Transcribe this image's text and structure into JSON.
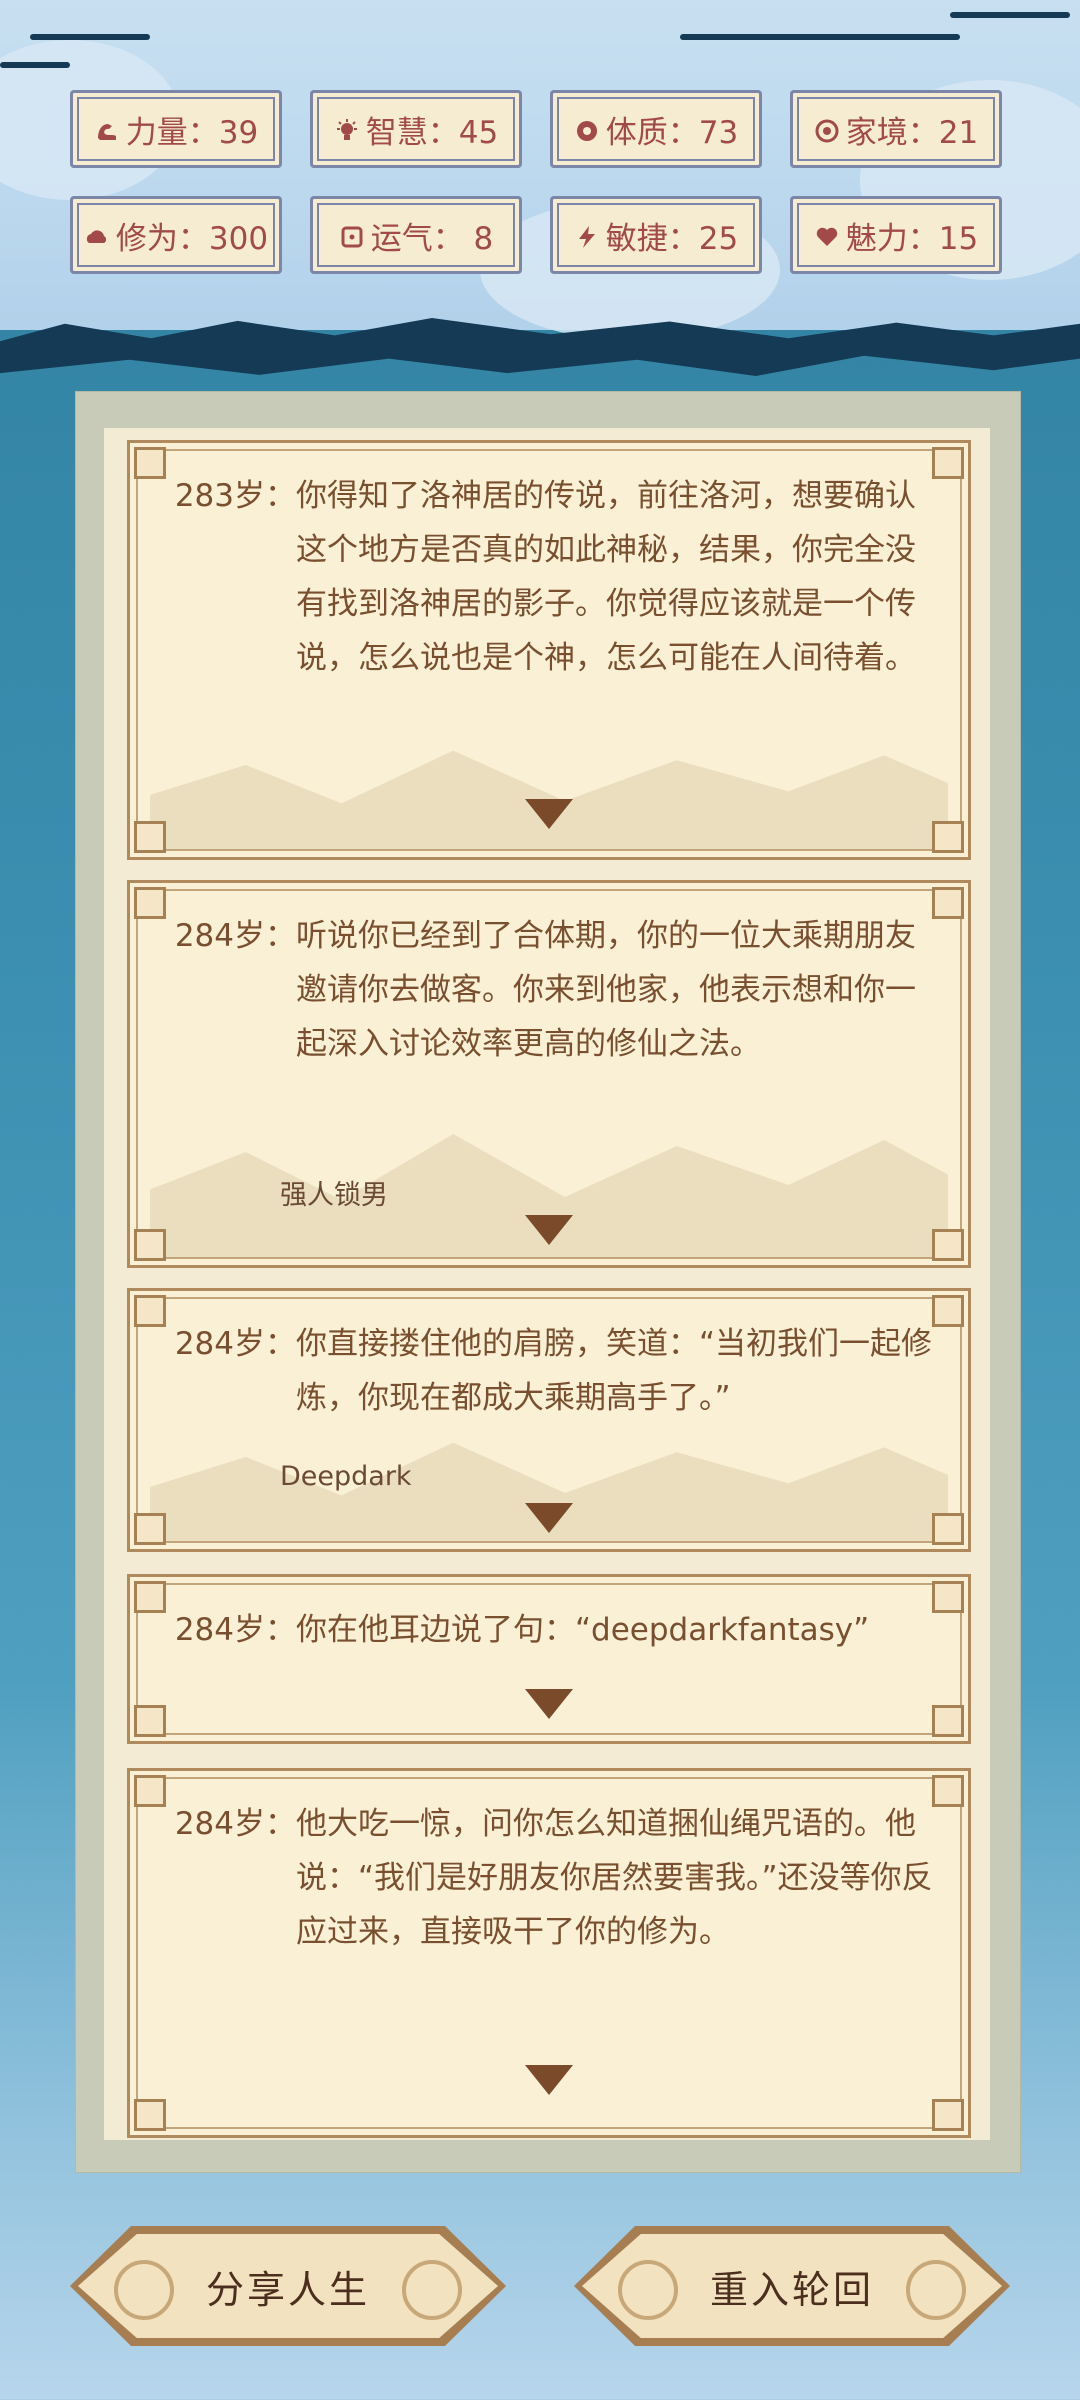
{
  "stats": [
    {
      "icon": "arm-icon",
      "label": "力量：39"
    },
    {
      "icon": "bulb-icon",
      "label": "智慧：45"
    },
    {
      "icon": "gear-icon",
      "label": "体质：73"
    },
    {
      "icon": "family-icon",
      "label": "家境：21"
    },
    {
      "icon": "cloud-icon",
      "label": "修为：300"
    },
    {
      "icon": "dice-icon",
      "label": "运气：  8"
    },
    {
      "icon": "lightning-icon",
      "label": "敏捷：25"
    },
    {
      "icon": "heart-icon",
      "label": "魅力：15"
    }
  ],
  "events": [
    {
      "age": "283岁：",
      "text": "你得知了洛神居的传说，前往洛河，想要确认这个地方是否真的如此神秘，结果，你完全没有找到洛神居的影子。你觉得应该就是一个传说，怎么说也是个神，怎么可能在人间待着。",
      "sub": ""
    },
    {
      "age": "284岁：",
      "text": "听说你已经到了合体期，你的一位大乘期朋友邀请你去做客。你来到他家，他表示想和你一起深入讨论效率更高的修仙之法。",
      "sub": "强人锁男"
    },
    {
      "age": "284岁：",
      "text": "你直接搂住他的肩膀，笑道：“当初我们一起修炼，你现在都成大乘期高手了。”",
      "sub": "Deepdark"
    },
    {
      "age": "284岁：",
      "text": "你在他耳边说了句：“deepdarkfantasy”",
      "sub": ""
    },
    {
      "age": "284岁：",
      "text": "他大吃一惊，问你怎么知道捆仙绳咒语的。他说：“我们是好朋友你居然要害我。”还没等你反应过来，直接吸干了你的修为。",
      "sub": ""
    }
  ],
  "buttons": {
    "share": "分享人生",
    "restart": "重入轮回"
  },
  "colors": {
    "stat_text": "#a24a4a",
    "card_bg": "#f9f0d6",
    "event_text": "#7a4f2f",
    "panel": "#c7cbb8"
  }
}
